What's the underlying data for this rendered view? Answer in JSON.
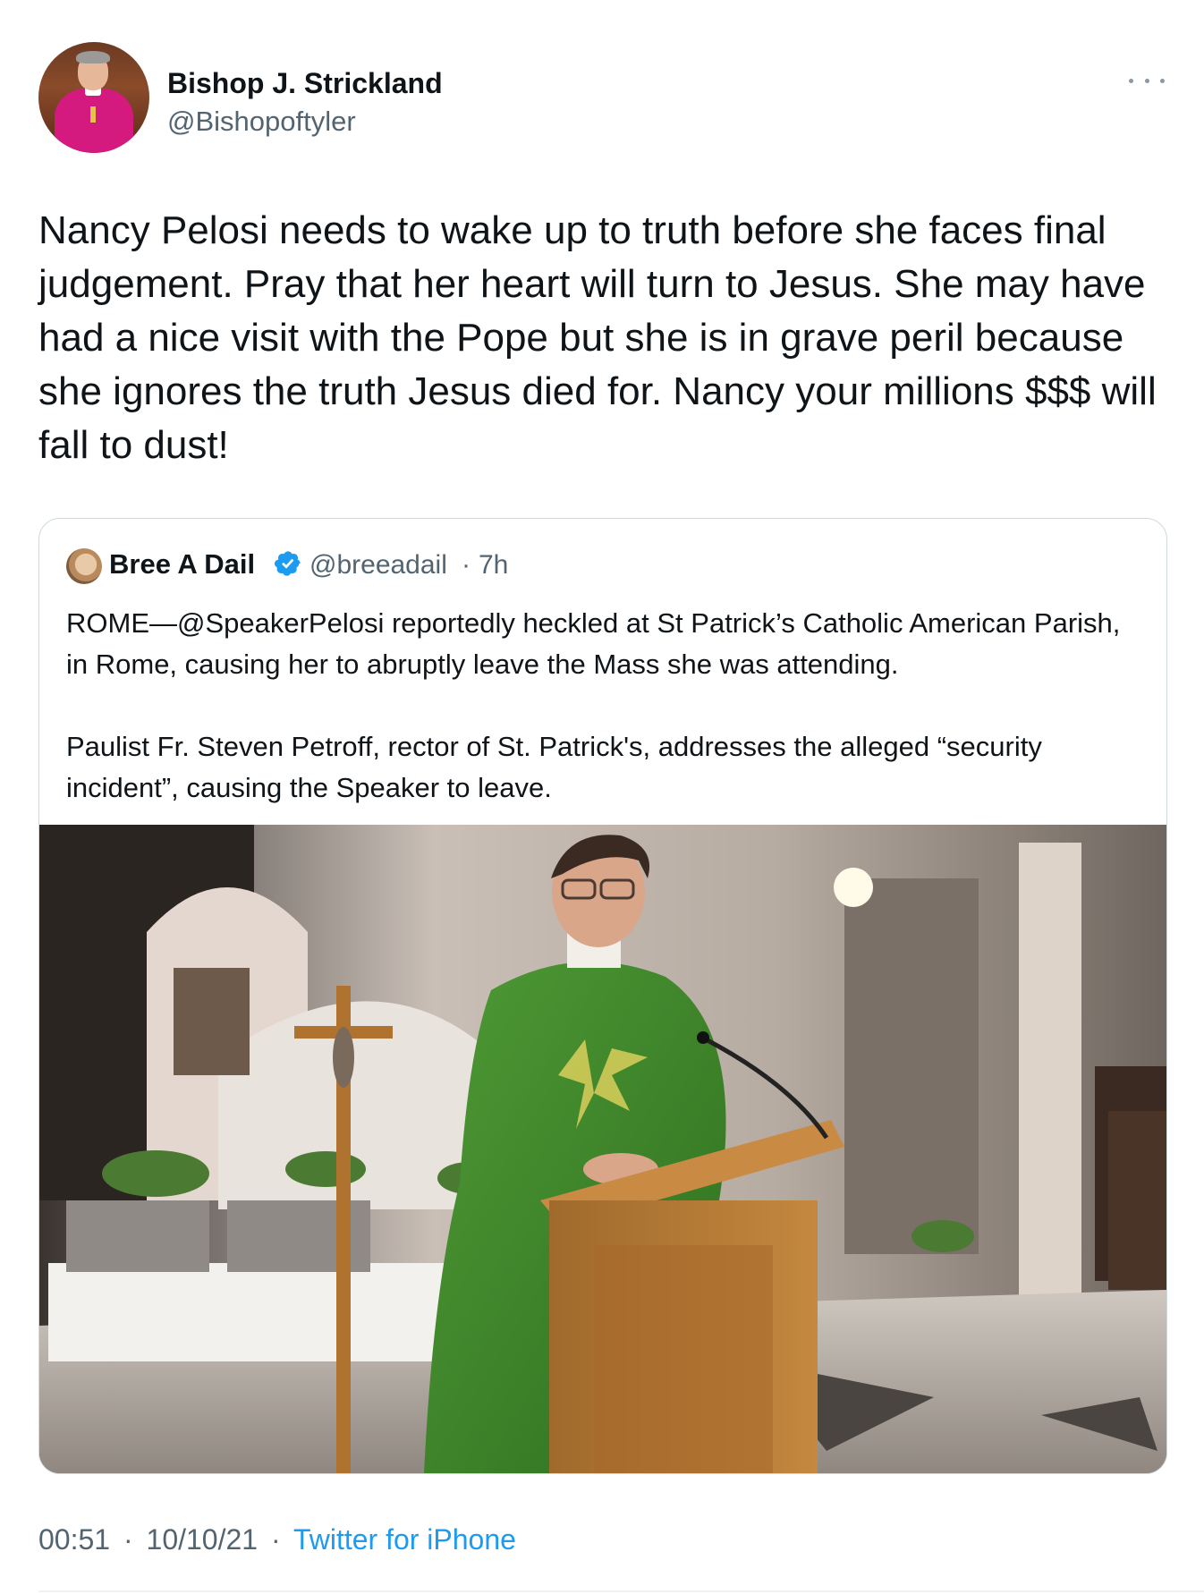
{
  "tweet": {
    "author": {
      "name": "Bishop J. Strickland",
      "handle": "@Bishopoftyler"
    },
    "text": "Nancy Pelosi needs to wake up to truth before she faces final judgement. Pray that her heart will turn to Jesus. She may have had a nice visit with the Pope but she is in grave peril because she ignores the truth Jesus died for. Nancy your millions $$$ will fall to dust!",
    "more_icon": "ellipsis-icon",
    "time": "00:51",
    "date": "10/10/21",
    "source": "Twitter for iPhone",
    "separator": "·"
  },
  "quoted": {
    "author": {
      "name": "Bree A Dail",
      "handle": "@breeadail",
      "verified": true
    },
    "age": "7h",
    "separator": "·",
    "paragraphs": [
      "ROME—@SpeakerPelosi reportedly heckled at St Patrick’s Catholic American Parish, in Rome, causing her to abruptly leave the Mass she was attending.",
      "Paulist Fr. Steven Petroff, rector of St. Patrick's, addresses the alleged “security incident”, causing the Speaker to leave."
    ]
  },
  "colors": {
    "text": "#0f1419",
    "secondary": "#536471",
    "link": "#1d9bf0",
    "border": "#cfd9de",
    "vestment": "#3f8a2c"
  }
}
